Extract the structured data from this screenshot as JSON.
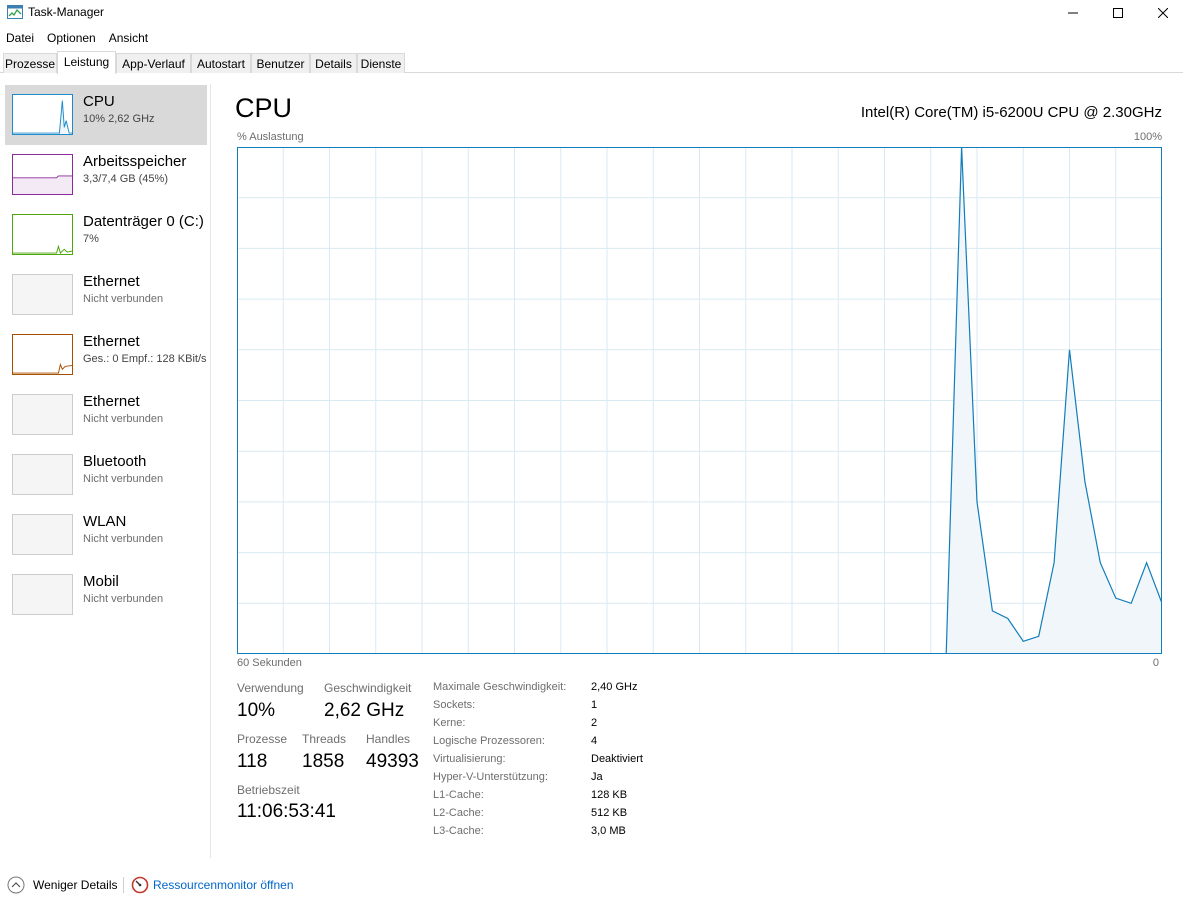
{
  "window": {
    "title": "Task-Manager"
  },
  "menu": [
    "Datei",
    "Optionen",
    "Ansicht"
  ],
  "tabs": [
    {
      "label": "Prozesse",
      "active": false
    },
    {
      "label": "Leistung",
      "active": true
    },
    {
      "label": "App-Verlauf",
      "active": false
    },
    {
      "label": "Autostart",
      "active": false
    },
    {
      "label": "Benutzer",
      "active": false
    },
    {
      "label": "Details",
      "active": false
    },
    {
      "label": "Dienste",
      "active": false
    }
  ],
  "sidebar": {
    "items": [
      {
        "title": "CPU",
        "sub": "10%  2,62 GHz",
        "color": "#1d8ac9",
        "selected": true,
        "icon": "cpu-graph-icon"
      },
      {
        "title": "Arbeitsspeicher",
        "sub": "3,3/7,4 GB (45%)",
        "color": "#8b2a9b",
        "selected": false,
        "icon": "memory-graph-icon"
      },
      {
        "title": "Datenträger 0 (C:)",
        "sub": "7%",
        "color": "#4da60c",
        "selected": false,
        "icon": "disk-graph-icon"
      },
      {
        "title": "Ethernet",
        "sub": "Nicht verbunden",
        "color": "#cccccc",
        "selected": false,
        "icon": "ethernet-graph-icon"
      },
      {
        "title": "Ethernet",
        "sub": "Ges.: 0  Empf.: 128 KBit/s",
        "color": "#a74f01",
        "selected": false,
        "icon": "ethernet-graph-icon"
      },
      {
        "title": "Ethernet",
        "sub": "Nicht verbunden",
        "color": "#cccccc",
        "selected": false,
        "icon": "ethernet-graph-icon"
      },
      {
        "title": "Bluetooth",
        "sub": "Nicht verbunden",
        "color": "#cccccc",
        "selected": false,
        "icon": "bluetooth-graph-icon"
      },
      {
        "title": "WLAN",
        "sub": "Nicht verbunden",
        "color": "#cccccc",
        "selected": false,
        "icon": "wlan-graph-icon"
      },
      {
        "title": "Mobil",
        "sub": "Nicht verbunden",
        "color": "#cccccc",
        "selected": false,
        "icon": "mobile-graph-icon"
      }
    ]
  },
  "main": {
    "title": "CPU",
    "cpu_name": "Intel(R) Core(TM) i5-6200U CPU @ 2.30GHz",
    "axis_top_left": "% Auslastung",
    "axis_top_right": "100%",
    "axis_bottom_left": "60 Sekunden",
    "axis_bottom_right": "0"
  },
  "chart_data": {
    "type": "area",
    "xlabel": "60 Sekunden",
    "ylabel": "% Auslastung",
    "ylim": [
      0,
      100
    ],
    "xlim": [
      60,
      0
    ],
    "color": "#117dbb",
    "fill": "#f1f6fa",
    "grid_color": "#d9eaf4",
    "grid": true,
    "x": [
      14,
      13,
      12,
      11,
      10,
      9,
      8,
      7,
      6,
      5,
      4,
      3,
      2,
      1,
      0
    ],
    "values": [
      0,
      100,
      30,
      8.5,
      7,
      2.5,
      3.5,
      18,
      60,
      34,
      18,
      11,
      10,
      18,
      10
    ]
  },
  "stats": {
    "usage_label": "Verwendung",
    "usage_value": "10%",
    "speed_label": "Geschwindigkeit",
    "speed_value": "2,62 GHz",
    "processes_label": "Prozesse",
    "processes_value": "118",
    "threads_label": "Threads",
    "threads_value": "1858",
    "handles_label": "Handles",
    "handles_value": "49393",
    "uptime_label": "Betriebszeit",
    "uptime_value": "11:06:53:41"
  },
  "specs": [
    {
      "key": "Maximale Geschwindigkeit:",
      "value": "2,40 GHz"
    },
    {
      "key": "Sockets:",
      "value": "1"
    },
    {
      "key": "Kerne:",
      "value": "2"
    },
    {
      "key": "Logische Prozessoren:",
      "value": "4"
    },
    {
      "key": "Virtualisierung:",
      "value": "Deaktiviert"
    },
    {
      "key": "Hyper-V-Unterstützung:",
      "value": "Ja"
    },
    {
      "key": "L1-Cache:",
      "value": "128 KB"
    },
    {
      "key": "L2-Cache:",
      "value": "512 KB"
    },
    {
      "key": "L3-Cache:",
      "value": "3,0 MB"
    }
  ],
  "footer": {
    "less_details": "Weniger Details",
    "resource_monitor": "Ressourcenmonitor öffnen"
  }
}
